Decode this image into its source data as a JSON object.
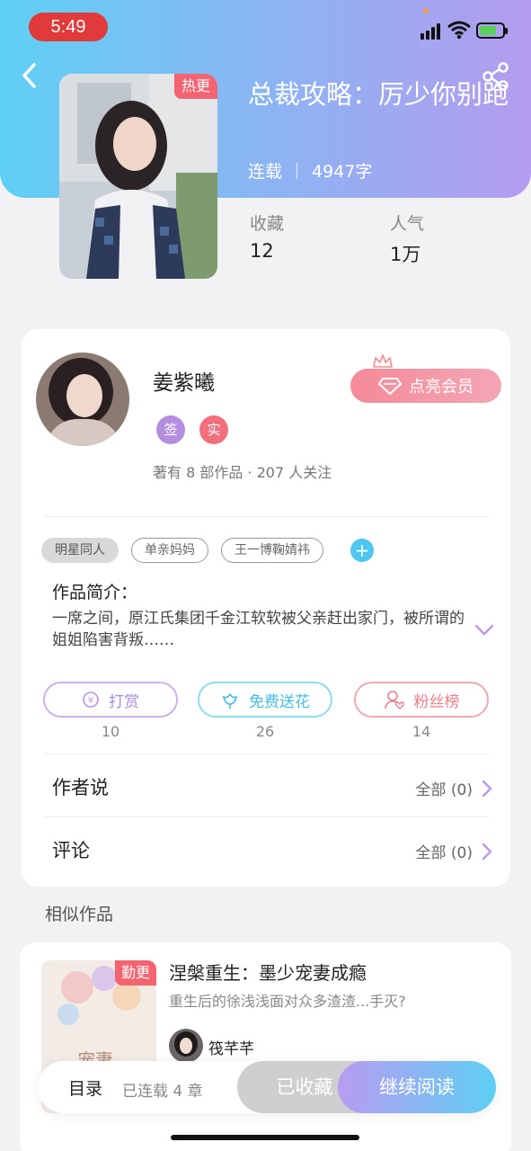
{
  "status_bar": {
    "time": "5:49"
  },
  "book": {
    "title": "总裁攻略：厉少你别跑",
    "hot_badge": "热更",
    "status": "连载",
    "word_count": "4947字",
    "stats": [
      {
        "label": "收藏",
        "value": "12"
      },
      {
        "label": "人气",
        "value": "1万"
      }
    ]
  },
  "author": {
    "name": "姜紫曦",
    "vip_button": "点亮会员",
    "badges": [
      {
        "text": "签",
        "color": "#b48fe0"
      },
      {
        "text": "实",
        "color": "#f2707e"
      }
    ],
    "info": "著有 8 部作品 · 207 人关注"
  },
  "tags": [
    "明星同人",
    "单亲妈妈",
    "王一博鞠婧祎"
  ],
  "intro": {
    "label": "作品简介：",
    "text": "一席之间，原江氏集团千金江软软被父亲赶出家门，被所谓的姐姐陷害背叛……"
  },
  "actions": [
    {
      "label": "打赏",
      "count": "10",
      "color": "#b796e6"
    },
    {
      "label": "免费送花",
      "count": "26",
      "color": "#5ccbed"
    },
    {
      "label": "粉丝榜",
      "count": "14",
      "color": "#f08a94"
    }
  ],
  "author_says": {
    "title": "作者说",
    "right": "全部 (0)"
  },
  "comments": {
    "title": "评论",
    "right": "全部 (0)"
  },
  "similar": {
    "section_title": "相似作品",
    "items": [
      {
        "badge": "勤更",
        "title": "涅槃重生：墨少宠妻成瘾",
        "desc": "重生后的徐浅浅面对众多渣渣...手灭?",
        "author": "筏芊芊"
      }
    ]
  },
  "bottom_bar": {
    "toc": "目录",
    "chapter_count": "已连载 4 章",
    "favorited": "已收藏",
    "continue": "继续阅读"
  }
}
